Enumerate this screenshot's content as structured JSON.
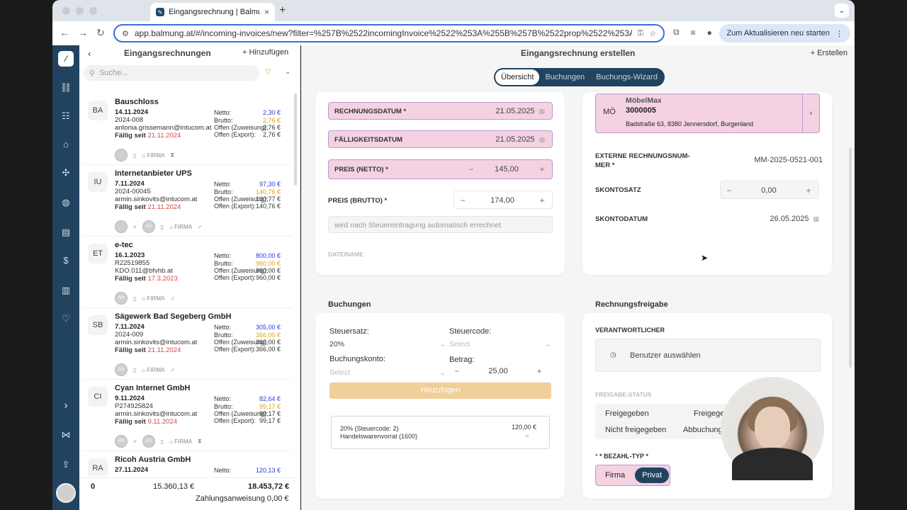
{
  "browser": {
    "tab_title": "Eingangsrechnung | Balmung",
    "url": "app.balmung.at/#/incoming-invoices/new?filter=%257B%2522incomingInvoice%2522%253A%255B%257B%2522prop%2522%253A%2522...",
    "update_button": "Zum Aktualisieren neu starten"
  },
  "rail": {
    "icons": [
      "pen-icon",
      "flow-icon",
      "users-icon",
      "bag-icon",
      "nodes-icon",
      "globe-icon",
      "book-icon",
      "dollar-icon",
      "chart-icon",
      "heart-icon",
      "chevron-right-icon",
      "share-icon",
      "upload-icon"
    ]
  },
  "list": {
    "title": "Eingangsrechnungen",
    "add_label": "+ Hinzufügen",
    "search_placeholder": "Suche...",
    "labels": {
      "netto": "Netto:",
      "brutto": "Brutto:",
      "offen_zuweisung": "Offen (Zuweisung):",
      "offen_export": "Offen (Export):",
      "faellig": "Fällig seit",
      "firma": "FIRMA"
    },
    "items": [
      {
        "abbr": "BA",
        "name": "Bauschloss",
        "date": "14.11.2024",
        "number": "2024-008",
        "email": "antonia.grissemann@intucom.at",
        "due": "21.11.2024",
        "netto": "2,30 €",
        "brutto": "2,76 €",
        "offen_zuweisung": "2,76 €",
        "offen_export": "2,76 €",
        "avatars": [
          ""
        ]
      },
      {
        "abbr": "IU",
        "name": "Internetanbieter UPS",
        "date": "7.11.2024",
        "number": "2024-00045",
        "email": "armin.sinkovits@intucom.at",
        "due": "21.11.2024",
        "netto": "97,30 €",
        "brutto": "140,76 €",
        "offen_zuweisung": "100,77 €",
        "offen_export": "140,76 €",
        "avatars": [
          "",
          "AO"
        ]
      },
      {
        "abbr": "ET",
        "name": "e-tec",
        "date": "16.1.2023",
        "number": "R22519855",
        "email": "KDO.011@bfvhb.at",
        "due": "17.3.2023",
        "netto": "800,00 €",
        "brutto": "960,00 €",
        "offen_zuweisung": "960,00 €",
        "offen_export": "960,00 €",
        "avatars": [
          "RH"
        ]
      },
      {
        "abbr": "SB",
        "name": "Sägewerk Bad Segeberg GmbH",
        "date": "7.11.2024",
        "number": "2024-009",
        "email": "armin.sinkovits@intucom.at",
        "due": "21.11.2024",
        "netto": "305,00 €",
        "brutto": "366,00 €",
        "offen_zuweisung": "366,00 €",
        "offen_export": "366,00 €",
        "avatars": [
          "AO"
        ]
      },
      {
        "abbr": "CI",
        "name": "Cyan Internet GmbH",
        "date": "9.11.2024",
        "number": "P274925824",
        "email": "armin.sinkovits@intucom.at",
        "due": "9.11.2024",
        "netto": "82,64 €",
        "brutto": "99,17 €",
        "offen_zuweisung": "99,17 €",
        "offen_export": "99,17 €",
        "avatars": [
          "RR",
          "AO"
        ]
      },
      {
        "abbr": "RA",
        "name": "Ricoh Austria GmbH",
        "date": "27.11.2024",
        "number": "",
        "email": "",
        "due": "",
        "netto": "120,13 €",
        "brutto": "",
        "offen_zuweisung": "",
        "offen_export": "",
        "avatars": []
      }
    ],
    "footer": {
      "count": "0",
      "netto_sum": "15.360,13 €",
      "brutto_sum": "18.453,72 €",
      "zahlungsanweisung": "Zahlungsanweisung  0,00 €"
    }
  },
  "main": {
    "title": "Eingangsrechnung erstellen",
    "create_label": "+ Erstellen",
    "tabs": [
      "Übersicht",
      "Buchungen",
      "Buchungs-Wizard"
    ],
    "left_card": {
      "rechnungsdatum_label": "RECHNUNGSDATUM *",
      "rechnungsdatum": "21.05.2025",
      "faelligkeitsdatum_label": "FÄLLIGKEITSDATUM",
      "faelligkeitsdatum": "21.05.2025",
      "preis_netto_label": "PREIS (NETTO) *",
      "preis_netto": "145,00",
      "preis_brutto_label": "PREIS (BRUTTO) *",
      "preis_brutto": "174,00",
      "auto_hint": "wird nach Steuereintragung automatisch errechnet",
      "dateiname_label": "DATEINAME"
    },
    "right_card": {
      "supplier_abbr": "MÖ",
      "supplier_name": "MöbelMax",
      "supplier_id": "3000005",
      "supplier_address": "Badstraße 63, 8380 Jennersdorf, Burgenland",
      "ext_nr_label_1": "EXTERNE RECHNUNGSNUM-",
      "ext_nr_label_2": "MER *",
      "ext_nr": "MM-2025-0521-001",
      "skontosatz_label": "SKONTOSATZ",
      "skontosatz": "0,00",
      "skontodatum_label": "SKONTODATUM",
      "skontodatum": "26.05.2025"
    },
    "buchungen": {
      "title": "Buchungen",
      "steuersatz_label": "Steuersatz:",
      "steuersatz": "20%",
      "steuercode_label": "Steuercode:",
      "steuercode_placeholder": "Select",
      "buchungskonto_label": "Buchungskonto:",
      "buchungskonto_placeholder": "Select",
      "betrag_label": "Betrag:",
      "betrag": "25,00",
      "add_button": "Hinzufügen",
      "entry_line1": "20% (Steuercode: 2)",
      "entry_line2": "Handelswarenvorrat (1600)",
      "entry_amount": "120,00 €"
    },
    "freigabe": {
      "title": "Rechnungsfreigabe",
      "verantwortlicher_label": "VERANTWORTLICHER",
      "user_select": "Benutzer auswählen",
      "status_label": "FREIGABE-STATUS",
      "status_options": [
        "Freigegeben",
        "Freigege",
        "Nicht freigegeben",
        "Abbuchung"
      ],
      "bezahltyp_label": "* BEZAHL-TYP *",
      "bezahltyp_options": [
        "Firma",
        "Privat"
      ]
    }
  }
}
